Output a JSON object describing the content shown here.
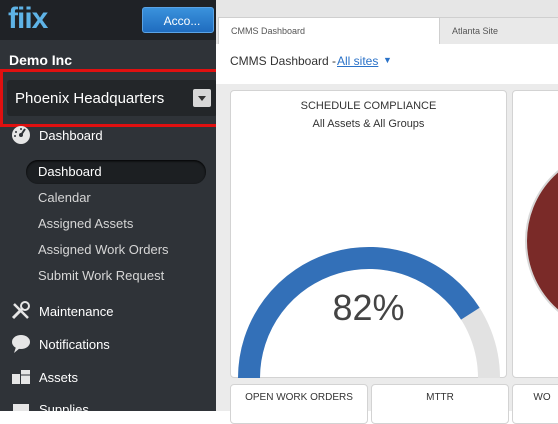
{
  "header": {
    "logo": "fiix",
    "account_label": "Acco..."
  },
  "sidebar": {
    "org_name": "Demo Inc",
    "site_selector": {
      "selected": "Phoenix Headquarters"
    },
    "sections": [
      {
        "label": "Dashboard",
        "icon": "dashboard-gauge-icon"
      },
      {
        "label": "Maintenance",
        "icon": "tools-icon"
      },
      {
        "label": "Notifications",
        "icon": "speech-bubble-icon"
      },
      {
        "label": "Assets",
        "icon": "boxes-icon"
      },
      {
        "label": "Supplies",
        "icon": "supplies-icon"
      }
    ],
    "dashboard_items": [
      {
        "label": "Dashboard",
        "active": true
      },
      {
        "label": "Calendar"
      },
      {
        "label": "Assigned Assets"
      },
      {
        "label": "Assigned Work Orders"
      },
      {
        "label": "Submit Work Request"
      }
    ]
  },
  "main": {
    "tabs": [
      {
        "label": "CMMS Dashboard",
        "active": true
      },
      {
        "label": "Atlanta Site"
      }
    ],
    "title": "CMMS Dashboard -",
    "site_filter": "All sites",
    "cards": {
      "schedule_compliance": {
        "title": "SCHEDULE COMPLIANCE",
        "subtitle": "All Assets & All Groups",
        "value_label": "82%",
        "fraction": 0.82,
        "accent_color": "#3370b8",
        "track_color": "#e2e2e2"
      },
      "open_work_orders": {
        "title": "OPEN WORK ORDERS"
      },
      "mttr": {
        "title": "MTTR"
      },
      "right_partial": {
        "title": "WO"
      }
    }
  },
  "colors": {
    "highlight_box": "#e01010",
    "sidebar_bg": "#2f3338",
    "brand": "#5eb3e6"
  }
}
